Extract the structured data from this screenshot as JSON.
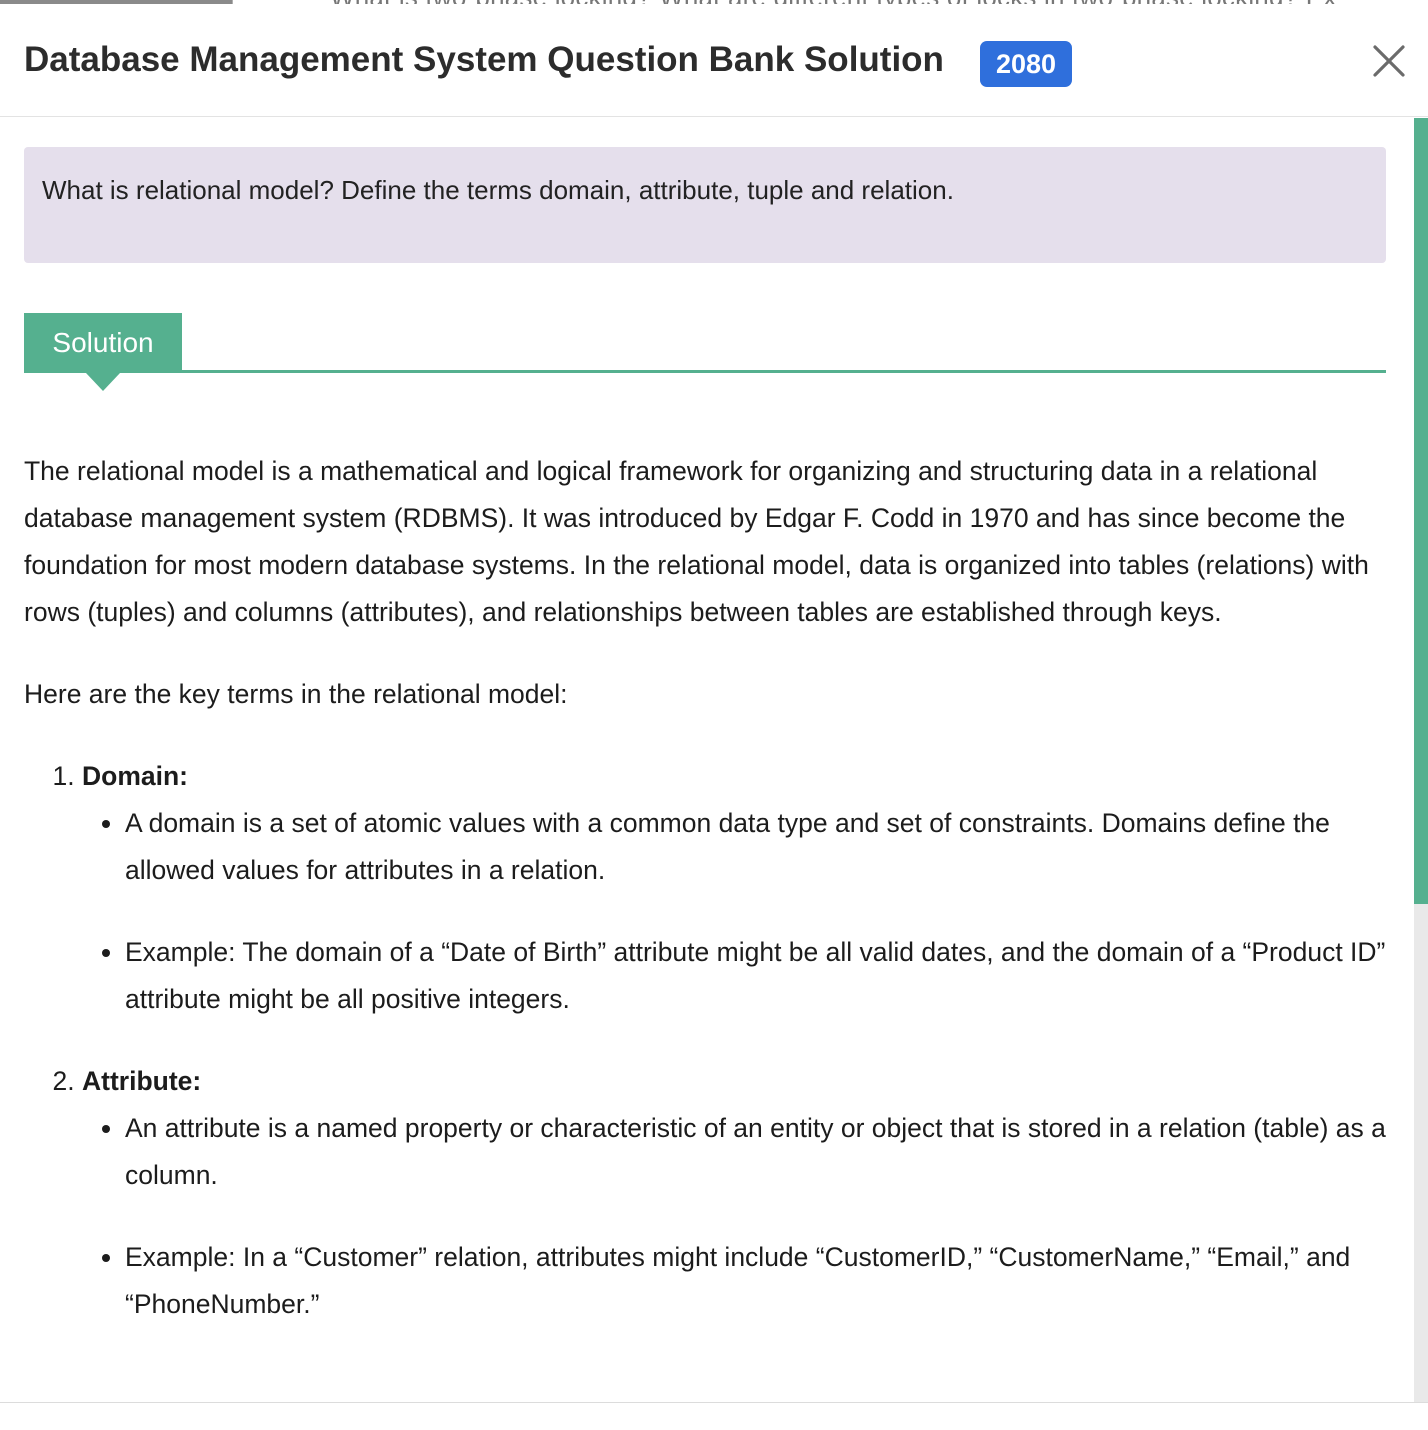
{
  "background": {
    "peek_text": "What is two-phase locking? What are different types of locks in two-phase locking? Ex"
  },
  "header": {
    "title": "Database Management System Question Bank Solution",
    "year_badge": "2080",
    "close_icon": "close-icon"
  },
  "question": {
    "text": "What is relational model? Define the terms domain, attribute, tuple and relation."
  },
  "solution_tab": {
    "label": "Solution"
  },
  "answer": {
    "intro": "The relational model is a mathematical and logical framework for organizing and structuring data in a relational database management system (RDBMS). It was introduced by Edgar F. Codd in 1970 and has since become the foundation for most modern database systems. In the relational model, data is organized into tables (relations) with rows (tuples) and columns (attributes), and relationships between tables are established through keys.",
    "lead": "Here are the key terms in the relational model:",
    "terms": [
      {
        "name": "Domain:",
        "points": [
          "A domain is a set of atomic values with a common data type and set of constraints. Domains define the allowed values for attributes in a relation.",
          "Example: The domain of a “Date of Birth” attribute might be all valid dates, and the domain of a “Product ID” attribute might be all positive integers."
        ]
      },
      {
        "name": "Attribute:",
        "points": [
          "An attribute is a named property or characteristic of an entity or object that is stored in a relation (table) as a column.",
          "Example: In a “Customer” relation, attributes might include “CustomerID,” “CustomerName,” “Email,” and “PhoneNumber.”"
        ]
      }
    ]
  },
  "colors": {
    "accent_green": "#55b08f",
    "badge_blue": "#2f6fdc",
    "question_bg": "#e5dfec"
  }
}
